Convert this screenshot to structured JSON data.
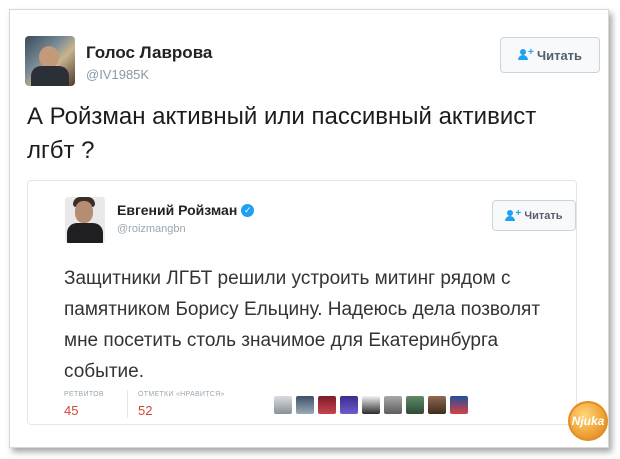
{
  "tweet": {
    "author_name": "Голос Лаврова",
    "author_handle": "@IV1985K",
    "follow_label": "Читать",
    "text": "А Ройзман активный или пассивный активист лгбт ?"
  },
  "quoted_tweet": {
    "author_name": "Евгений Ройзман",
    "author_handle": "@roizmangbn",
    "follow_label": "Читать",
    "text": "Защитники ЛГБТ решили устроить митинг рядом с памятником Борису Ельцину. Надеюсь дела позволят мне посетить столь значимое для Екатеринбурга событие.",
    "retweets_label": "РЕТВИТОВ",
    "retweets_count": "45",
    "likes_label": "ОТМЕТКИ «НРАВИТСЯ»",
    "likes_count": "52",
    "liker_avatar_count": 9
  },
  "watermark": {
    "text": "Njuka"
  },
  "colors": {
    "accent": "#1da1f2",
    "stat_value": "#d0463a",
    "watermark": "#f0a63a"
  }
}
